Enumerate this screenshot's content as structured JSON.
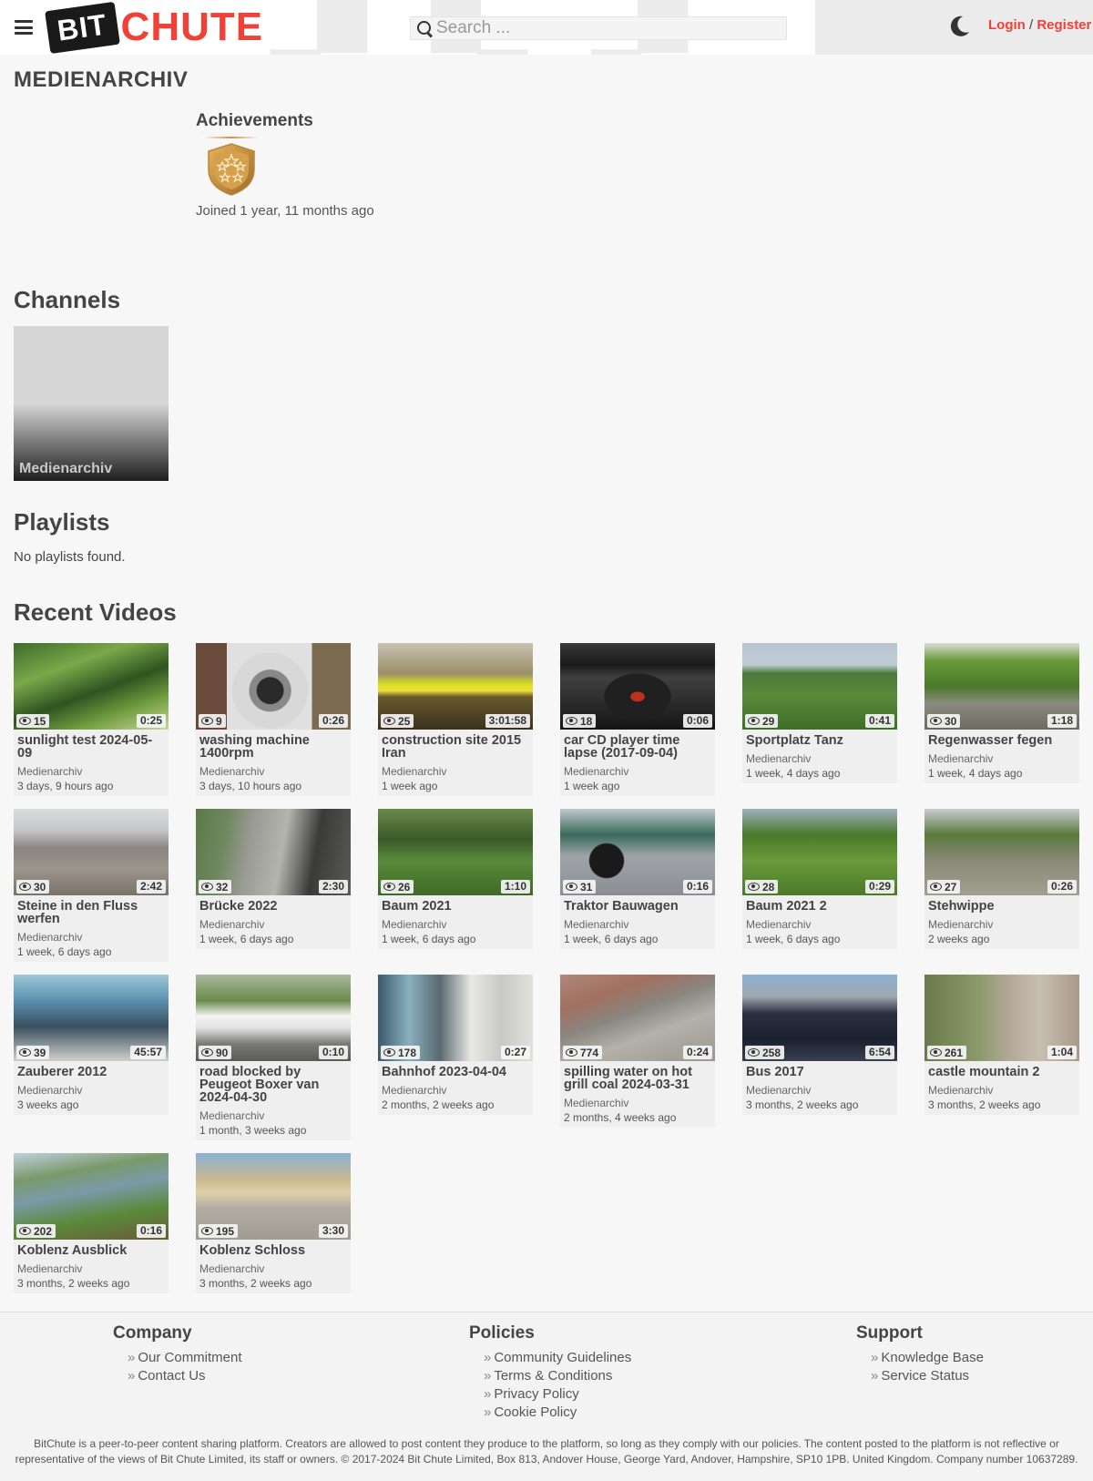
{
  "header": {
    "logo_bit": "BIT",
    "logo_chute": "CHUTE",
    "search_placeholder": "Search ...",
    "login": "Login",
    "separator": "/",
    "register": "Register"
  },
  "profile": {
    "name": "MEDIENARCHIV",
    "achievements_title": "Achievements",
    "joined": "Joined 1 year, 11 months ago"
  },
  "sections": {
    "channels": "Channels",
    "playlists": "Playlists",
    "recent_videos": "Recent Videos"
  },
  "channels": [
    {
      "name": "Medienarchiv"
    }
  ],
  "playlists_empty": "No playlists found.",
  "videos": [
    {
      "title": "sunlight test 2024-05-09",
      "channel": "Medienarchiv",
      "age": "3 days, 9 hours ago",
      "views": "15",
      "duration": "0:25",
      "thumb": "grass"
    },
    {
      "title": "washing machine 1400rpm",
      "channel": "Medienarchiv",
      "age": "3 days, 10 hours ago",
      "views": "9",
      "duration": "0:26",
      "thumb": "washer"
    },
    {
      "title": "construction site 2015 Iran",
      "channel": "Medienarchiv",
      "age": "1 week ago",
      "views": "25",
      "duration": "3:01:58",
      "thumb": "yellow"
    },
    {
      "title": "car CD player time lapse (2017-09-04)",
      "channel": "Medienarchiv",
      "age": "1 week ago",
      "views": "18",
      "duration": "0:06",
      "thumb": "dash"
    },
    {
      "title": "Sportplatz Tanz",
      "channel": "Medienarchiv",
      "age": "1 week, 4 days ago",
      "views": "29",
      "duration": "0:41",
      "thumb": "field"
    },
    {
      "title": "Regenwasser fegen",
      "channel": "Medienarchiv",
      "age": "1 week, 4 days ago",
      "views": "30",
      "duration": "1:18",
      "thumb": "garden"
    },
    {
      "title": "Steine in den Fluss werfen",
      "channel": "Medienarchiv",
      "age": "1 week, 6 days ago",
      "views": "30",
      "duration": "2:42",
      "thumb": "shore"
    },
    {
      "title": "Brücke 2022",
      "channel": "Medienarchiv",
      "age": "1 week, 6 days ago",
      "views": "32",
      "duration": "2:30",
      "thumb": "bridge"
    },
    {
      "title": "Baum 2021",
      "channel": "Medienarchiv",
      "age": "1 week, 6 days ago",
      "views": "26",
      "duration": "1:10",
      "thumb": "tree"
    },
    {
      "title": "Traktor Bauwagen",
      "channel": "Medienarchiv",
      "age": "1 week, 6 days ago",
      "views": "31",
      "duration": "0:16",
      "thumb": "tractor"
    },
    {
      "title": "Baum 2021 2",
      "channel": "Medienarchiv",
      "age": "1 week, 6 days ago",
      "views": "28",
      "duration": "0:29",
      "thumb": "tree2"
    },
    {
      "title": "Stehwippe",
      "channel": "Medienarchiv",
      "age": "2 weeks ago",
      "views": "27",
      "duration": "0:26",
      "thumb": "park"
    },
    {
      "title": "Zauberer 2012",
      "channel": "Medienarchiv",
      "age": "3 weeks ago",
      "views": "39",
      "duration": "45:57",
      "thumb": "room"
    },
    {
      "title": "road blocked by Peugeot Boxer van 2024-04-30",
      "channel": "Medienarchiv",
      "age": "1 month, 3 weeks ago",
      "views": "90",
      "duration": "0:10",
      "thumb": "van"
    },
    {
      "title": "Bahnhof 2023-04-04",
      "channel": "Medienarchiv",
      "age": "2 months, 2 weeks ago",
      "views": "178",
      "duration": "0:27",
      "thumb": "station"
    },
    {
      "title": "spilling water on hot grill coal 2024-03-31",
      "channel": "Medienarchiv",
      "age": "2 months, 4 weeks ago",
      "views": "774",
      "duration": "0:24",
      "thumb": "grill"
    },
    {
      "title": "Bus 2017",
      "channel": "Medienarchiv",
      "age": "3 months, 2 weeks ago",
      "views": "258",
      "duration": "6:54",
      "thumb": "bus"
    },
    {
      "title": "castle mountain 2",
      "channel": "Medienarchiv",
      "age": "3 months, 2 weeks ago",
      "views": "261",
      "duration": "1:04",
      "thumb": "castle"
    },
    {
      "title": "Koblenz Ausblick",
      "channel": "Medienarchiv",
      "age": "3 months, 2 weeks ago",
      "views": "202",
      "duration": "0:16",
      "thumb": "river"
    },
    {
      "title": "Koblenz Schloss",
      "channel": "Medienarchiv",
      "age": "3 months, 2 weeks ago",
      "views": "195",
      "duration": "3:30",
      "thumb": "schloss"
    }
  ],
  "footer": {
    "company": {
      "title": "Company",
      "links": [
        "Our Commitment",
        "Contact Us"
      ]
    },
    "policies": {
      "title": "Policies",
      "links": [
        "Community Guidelines",
        "Terms & Conditions",
        "Privacy Policy",
        "Cookie Policy"
      ]
    },
    "support": {
      "title": "Support",
      "links": [
        "Knowledge Base",
        "Service Status"
      ]
    },
    "disclaimer": "BitChute is a peer-to-peer content sharing platform. Creators are allowed to post content they produce to the platform, so long as they comply with our policies. The content posted to the platform is not reflective or representative of the views of Bit Chute Limited, its staff or owners. © 2017-2024 Bit Chute Limited, Box 813, Andover House, George Yard, Andover, Hampshire, SP10 1PB. United Kingdom. Company number 10637289."
  },
  "colors": {
    "brand_red": "#ef4137",
    "text": "#444444",
    "background": "#f7f7f7",
    "card": "#efefef"
  }
}
